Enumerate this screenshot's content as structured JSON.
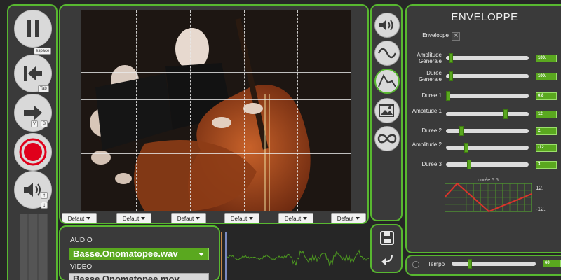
{
  "transport": {
    "pause_hint": "espace",
    "rewind_hint": "Tab",
    "forward_hint_v": "V",
    "forward_hint_b": "B"
  },
  "video": {
    "track_dropdowns": [
      "Defaut",
      "Defaut",
      "Defaut",
      "Defaut",
      "Defaut",
      "Defaut"
    ]
  },
  "media": {
    "audio_label": "AUDIO",
    "audio_file": "Basse.Onomatopee.wav",
    "video_label": "VIDEO",
    "video_file": "Basse.Onomatopee.mov"
  },
  "tools": {
    "icons": [
      "speaker-icon",
      "sine-wave-icon",
      "envelope-shape-icon",
      "image-icon",
      "infinity-icon",
      "save-icon",
      "undo-icon"
    ]
  },
  "envelope": {
    "title": "ENVELOPPE",
    "enable_label": "Enveloppe",
    "enable_mark": "✕",
    "rows": [
      {
        "label": "Amplitude Générale",
        "value": "100.",
        "level": 0.04
      },
      {
        "label": "Durée Generale",
        "value": "100.",
        "level": 0.04
      },
      {
        "label": "Duree 1",
        "value": "0.8",
        "level": 0.0
      },
      {
        "label": "Amplitude 1",
        "value": "12.",
        "level": 0.73
      },
      {
        "label": "Duree 2",
        "value": "2.",
        "level": 0.17
      },
      {
        "label": "Amplitude 2",
        "value": "-12.",
        "level": 0.23
      },
      {
        "label": "Duree 3",
        "value": "3.",
        "level": 0.27
      }
    ],
    "chart": {
      "title": "durée 5.5",
      "ymax_label": "12.",
      "ymin_label": "-12."
    }
  },
  "tempo": {
    "label": "Tempo",
    "value": "60.",
    "level": 0.2
  },
  "colors": {
    "accent": "#58b830",
    "record": "#e0001b",
    "envelope_line": "#d9342b"
  },
  "chart_data": {
    "type": "line",
    "title": "durée 5.5",
    "x": [
      0,
      0.8,
      2.8,
      5.5
    ],
    "y": [
      0,
      12,
      -12,
      3
    ],
    "ylim": [
      -12,
      12
    ],
    "xlim": [
      0,
      5.5
    ],
    "grid": true
  }
}
